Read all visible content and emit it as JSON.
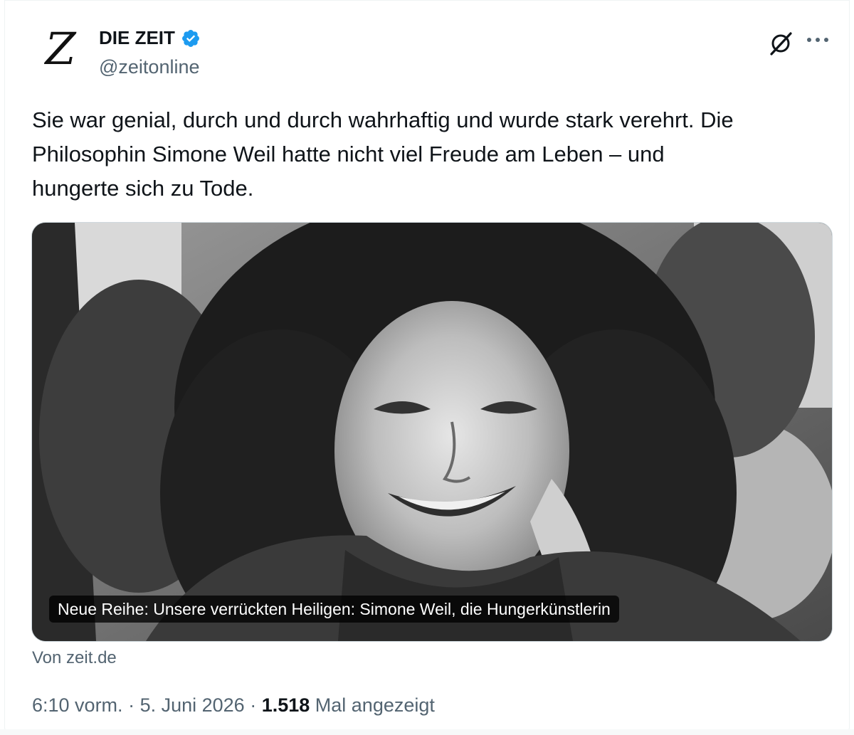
{
  "account": {
    "name": "DIE ZEIT",
    "handle": "@zeitonline",
    "avatar_letter": "Z",
    "verified": true,
    "verified_color": "#1d9bf0"
  },
  "tweet": {
    "lines": [
      "Sie war genial, durch und durch wahrhaftig und wurde stark verehrt. Die",
      "Philosophin Simone Weil hatte nicht viel Freude am Leben – und",
      "hungerte sich zu Tode."
    ]
  },
  "card": {
    "caption": "Neue Reihe: Unsere verrückten Heiligen: Simone Weil, die Hungerkünstlerin",
    "source": "Von zeit.de"
  },
  "meta": {
    "time": "6:10 vorm.",
    "separator": " · ",
    "date": "5. Juni 2026",
    "views_count": "1.518",
    "views_label": "Mal angezeigt"
  },
  "icons": {
    "grok": "grok-icon",
    "more": "more-horizontal-icon",
    "verified": "verified-badge-icon"
  },
  "colors": {
    "text_primary": "#0f1419",
    "text_secondary": "#536471",
    "border": "#cfd9de"
  }
}
